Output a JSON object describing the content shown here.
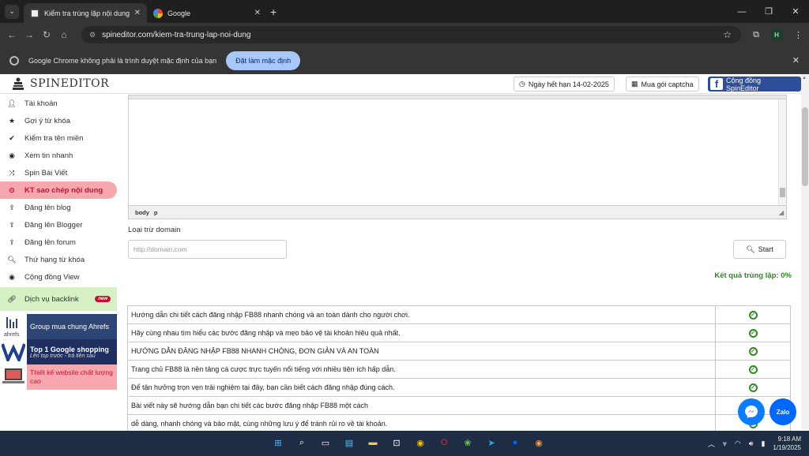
{
  "browser": {
    "tabs": [
      {
        "title": "Kiểm tra trùng lặp nội dung",
        "active": true
      },
      {
        "title": "Google",
        "active": false
      }
    ],
    "url": "spineditor.com/kiem-tra-trung-lap-noi-dung",
    "profile_initial": "H",
    "infobar": {
      "message": "Google Chrome không phải là trình duyệt mặc định của bạn",
      "button": "Đặt làm mặc định"
    }
  },
  "header": {
    "logo": "SPINEDITOR",
    "expiry": "Ngày hết hạn 14-02-2025",
    "captcha": "Mua gói captcha",
    "community": "Cộng đồng SpinEditor"
  },
  "sidebar": {
    "items": [
      {
        "label": "Tài khoản",
        "icon": "user-icon"
      },
      {
        "label": "Gợi ý từ khóa",
        "icon": "star-icon"
      },
      {
        "label": "Kiểm tra tên miền",
        "icon": "check-icon"
      },
      {
        "label": "Xem tin nhanh",
        "icon": "eye-icon"
      },
      {
        "label": "Spin Bài Viết",
        "icon": "shuffle-icon"
      },
      {
        "label": "KT sao chép nội dung",
        "icon": "copy-icon",
        "active": true
      },
      {
        "label": "Đăng lên blog",
        "icon": "upload-icon"
      },
      {
        "label": "Đăng lên Blogger",
        "icon": "upload-icon"
      },
      {
        "label": "Đăng lên forum",
        "icon": "upload-icon"
      },
      {
        "label": "Thứ hạng từ khóa",
        "icon": "search-icon"
      },
      {
        "label": "Cộng đồng View",
        "icon": "eye-icon"
      }
    ],
    "backlink": {
      "label": "Dịch vụ backlink",
      "badge": "new"
    },
    "promos": {
      "ahrefs": {
        "label": "Group mua chung Ahrefs",
        "logo_text": "ahrefs"
      },
      "google": {
        "title": "Top 1 Google shopping",
        "subtitle": "Lên top trước - trả tiền sau"
      },
      "web": {
        "label": "Thiết kế website chất lượng cao"
      }
    }
  },
  "editor": {
    "path": [
      "body",
      "p"
    ]
  },
  "form": {
    "exclude_label": "Loại trừ domain",
    "domain_placeholder": "http://domain.com",
    "start_label": "Start"
  },
  "result": {
    "label": "Kết quả trùng lặp: 0%"
  },
  "results_rows": [
    "Hướng dẫn chi tiết cách đăng nhập FB88 nhanh chóng và an toàn dành cho người chơi.",
    "Hãy cùng nhau tìm hiểu các bước đăng nhập và mẹo bảo vệ tài khoản hiệu quả nhất.",
    "HƯỚNG DẪN ĐĂNG NHẬP FB88 NHANH CHÓNG, ĐƠN GIẢN VÀ AN TOÀN",
    "Trang chủ FB88 là nền tảng cá cược trực tuyến nổi tiếng với nhiều tiện ích hấp dẫn.",
    "Để tận hưởng trọn vẹn trải nghiệm tại đây, bạn cần biết cách đăng nhập đúng cách.",
    "Bài viết này sẽ hướng dẫn bạn chi tiết các bước đăng nhập FB88 một cách",
    "dễ dàng, nhanh chóng và bảo mật, cùng những lưu ý để tránh rủi ro về tài khoản."
  ],
  "chat": {
    "zalo": "Zalo"
  },
  "taskbar": {
    "time": "9:18 AM",
    "date": "1/19/2025"
  },
  "colors": {
    "accent_red": "#c8102e",
    "active_bg": "#f6a8ae",
    "result_green": "#2e8b1e",
    "fb_blue": "#2d4e9b"
  }
}
